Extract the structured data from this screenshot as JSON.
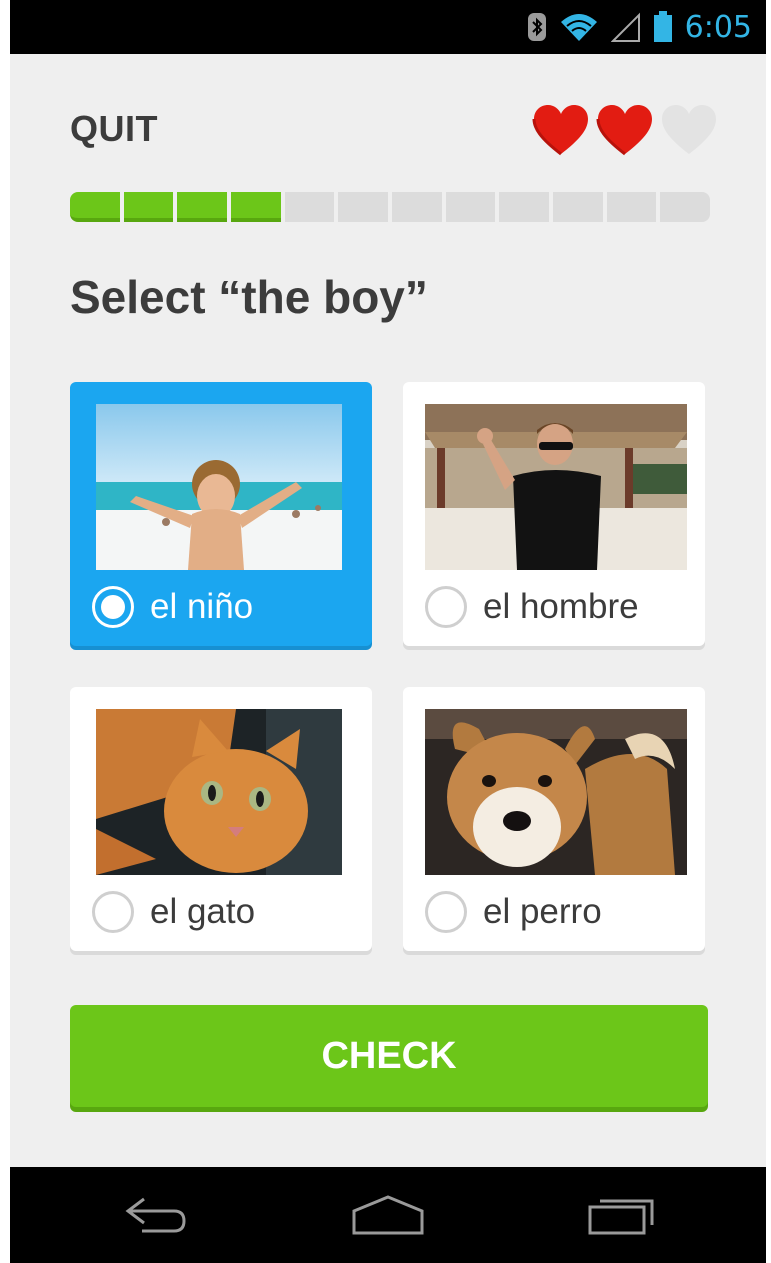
{
  "status_bar": {
    "time": "6:05",
    "icons": [
      "bluetooth-icon",
      "wifi-icon",
      "signal-icon",
      "battery-icon"
    ],
    "accent_color": "#33b5e5"
  },
  "header": {
    "quit_label": "QUIT",
    "hearts": {
      "total": 3,
      "remaining": 2,
      "filled_color": "#e21c12",
      "empty_color": "#e3e3e3"
    }
  },
  "progress": {
    "segments_total": 12,
    "segments_completed": 4,
    "fill_color": "#6cc619"
  },
  "prompt": {
    "text": "Select “the boy”"
  },
  "options": [
    {
      "label": "el niño",
      "image": "boy-at-beach",
      "selected": true
    },
    {
      "label": "el hombre",
      "image": "man-with-sunglasses",
      "selected": false
    },
    {
      "label": "el gato",
      "image": "orange-cat",
      "selected": false
    },
    {
      "label": "el perro",
      "image": "shiba-dog",
      "selected": false
    }
  ],
  "check_button": {
    "label": "CHECK",
    "color": "#6cc619"
  },
  "selection_color": "#1ba6f0",
  "nav_bar": {
    "buttons": [
      "back-icon",
      "home-icon",
      "recent-apps-icon"
    ]
  }
}
